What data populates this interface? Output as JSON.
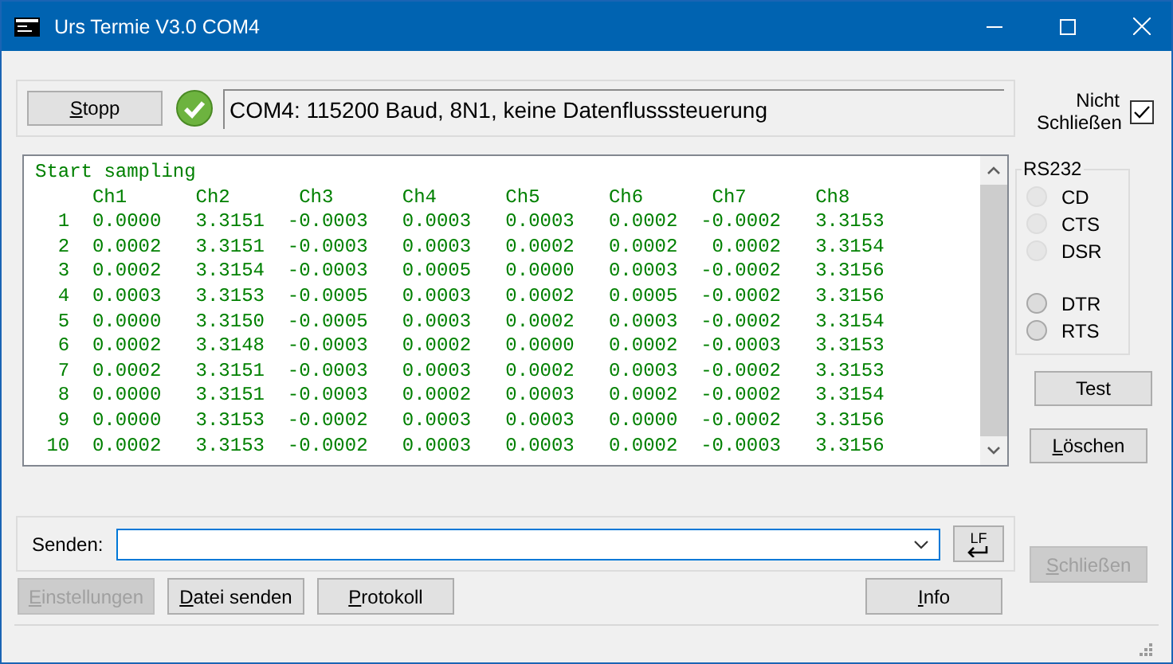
{
  "window": {
    "title": "Urs Termie V3.0 COM4"
  },
  "connection": {
    "button": "Stopp",
    "message": "COM4: 115200 Baud, 8N1, keine Datenflusssteuerung"
  },
  "keep_open": {
    "label": "Nicht Schließen",
    "checked": true
  },
  "rs232": {
    "title": "RS232",
    "inputs": [
      {
        "label": "CD",
        "disabled": true
      },
      {
        "label": "CTS",
        "disabled": true
      },
      {
        "label": "DSR",
        "disabled": true
      }
    ],
    "outputs": [
      {
        "label": "DTR",
        "disabled": false
      },
      {
        "label": "RTS",
        "disabled": false
      }
    ]
  },
  "test_button": "Test",
  "clear_button": "Löschen",
  "terminal": {
    "first_line": "Start sampling",
    "columns": [
      "Ch1",
      "Ch2",
      "Ch3",
      "Ch4",
      "Ch5",
      "Ch6",
      "Ch7",
      "Ch8"
    ],
    "rows": [
      {
        "index": "1",
        "values": [
          "0.0000",
          "3.3151",
          "-0.0003",
          "0.0003",
          "0.0003",
          "0.0002",
          "-0.0002",
          "3.3153"
        ]
      },
      {
        "index": "2",
        "values": [
          "0.0002",
          "3.3151",
          "-0.0003",
          "0.0003",
          "0.0002",
          "0.0002",
          "0.0002",
          "3.3154"
        ]
      },
      {
        "index": "3",
        "values": [
          "0.0002",
          "3.3154",
          "-0.0003",
          "0.0005",
          "0.0000",
          "0.0003",
          "-0.0002",
          "3.3156"
        ]
      },
      {
        "index": "4",
        "values": [
          "0.0003",
          "3.3153",
          "-0.0005",
          "0.0003",
          "0.0002",
          "0.0005",
          "-0.0002",
          "3.3156"
        ]
      },
      {
        "index": "5",
        "values": [
          "0.0000",
          "3.3150",
          "-0.0005",
          "0.0003",
          "0.0002",
          "0.0003",
          "-0.0002",
          "3.3154"
        ]
      },
      {
        "index": "6",
        "values": [
          "0.0002",
          "3.3148",
          "-0.0003",
          "0.0002",
          "0.0000",
          "0.0002",
          "-0.0003",
          "3.3153"
        ]
      },
      {
        "index": "7",
        "values": [
          "0.0002",
          "3.3151",
          "-0.0003",
          "0.0003",
          "0.0002",
          "0.0003",
          "-0.0002",
          "3.3153"
        ]
      },
      {
        "index": "8",
        "values": [
          "0.0000",
          "3.3151",
          "-0.0003",
          "0.0002",
          "0.0003",
          "0.0002",
          "-0.0002",
          "3.3154"
        ]
      },
      {
        "index": "9",
        "values": [
          "0.0000",
          "3.3153",
          "-0.0002",
          "0.0003",
          "0.0003",
          "0.0000",
          "-0.0002",
          "3.3156"
        ]
      },
      {
        "index": "10",
        "values": [
          "0.0002",
          "3.3153",
          "-0.0002",
          "0.0003",
          "0.0003",
          "0.0002",
          "-0.0003",
          "3.3156"
        ]
      }
    ]
  },
  "send": {
    "label": "Senden:",
    "lf_button": "LF"
  },
  "buttons": [
    {
      "label": "Einstellungen",
      "disabled": true
    },
    {
      "label": "Datei senden",
      "disabled": false
    },
    {
      "label": "Protokoll",
      "disabled": false
    },
    {
      "label": "Info",
      "disabled": false
    },
    {
      "label": "Schließen",
      "disabled": true
    }
  ]
}
